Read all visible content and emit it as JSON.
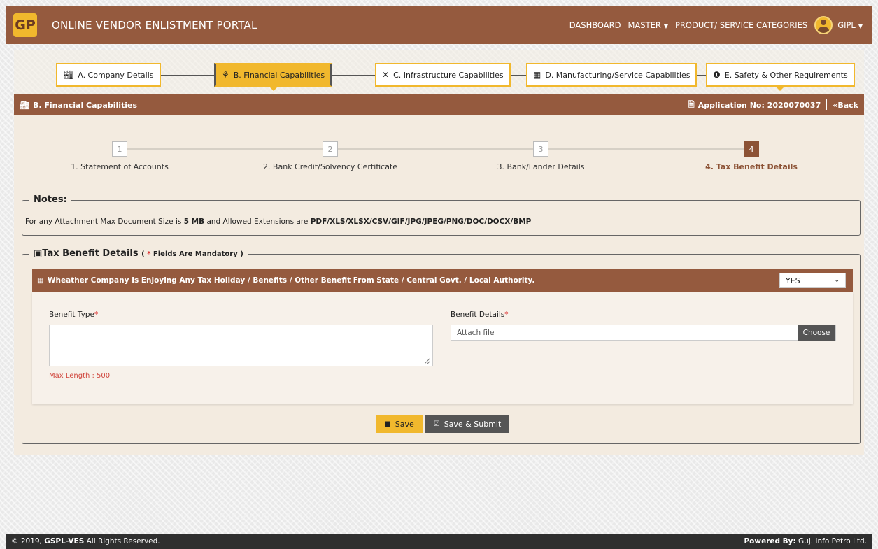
{
  "navbar": {
    "logo_text": "GP",
    "title": "ONLINE VENDOR ENLISTMENT PORTAL",
    "links": {
      "dashboard": "DASHBOARD",
      "master": "MASTER",
      "categories": "PRODUCT/ SERVICE CATEGORIES"
    },
    "user": "GIPL"
  },
  "tabs": [
    {
      "label": "A. Company Details",
      "icon": "factory-icon"
    },
    {
      "label": "B. Financial Capabilities",
      "icon": "growth-icon"
    },
    {
      "label": "C. Infrastructure Capabilities",
      "icon": "tools-icon"
    },
    {
      "label": "D. Manufacturing/Service Capabilities",
      "icon": "building-icon"
    },
    {
      "label": "E. Safety & Other Requirements",
      "icon": "exclamation-icon"
    }
  ],
  "panel": {
    "title": "B. Financial Capabilities",
    "application_label": "Application No: 2020070037",
    "back_label": "Back"
  },
  "wizard": {
    "steps": [
      {
        "number": "1",
        "label": "1. Statement of Accounts"
      },
      {
        "number": "2",
        "label": "2. Bank Credit/Solvency Certificate"
      },
      {
        "number": "3",
        "label": "3. Bank/Lander Details"
      },
      {
        "number": "4",
        "label": "4. Tax Benefit Details"
      }
    ]
  },
  "notes": {
    "legend": "Notes:",
    "prefix": "For any Attachment Max Document Size is ",
    "size": "5 MB",
    "middle": " and Allowed Extensions are ",
    "extensions": "PDF/XLS/XLSX/CSV/GIF/JPG/JPEG/PNG/DOC/DOCX/BMP"
  },
  "tax": {
    "legend": "Tax Benefit Details",
    "mandatory_star": "*",
    "mandatory_text": " Fields Are Mandatory )",
    "mandatory_open": "(",
    "question": "Wheather Company Is Enjoying Any Tax Holiday / Benefits / Other Benefit From State / Central Govt. / Local Authority.",
    "answer": "YES",
    "benefit_type_label": "Benefit Type",
    "benefit_details_label": "Benefit Details",
    "required_mark": "*",
    "max_length": "Max Length : 500",
    "file_placeholder": "Attach file",
    "choose_label": "Choose",
    "save_label": "Save",
    "submit_label": "Save & Submit"
  },
  "footer": {
    "copyright_prefix": "© 2019, ",
    "copyright_brand": "GSPL-VES",
    "copyright_suffix": " All Rights Reserved.",
    "powered_label": "Powered By:",
    "powered_by": " Guj. Info Petro Ltd."
  }
}
